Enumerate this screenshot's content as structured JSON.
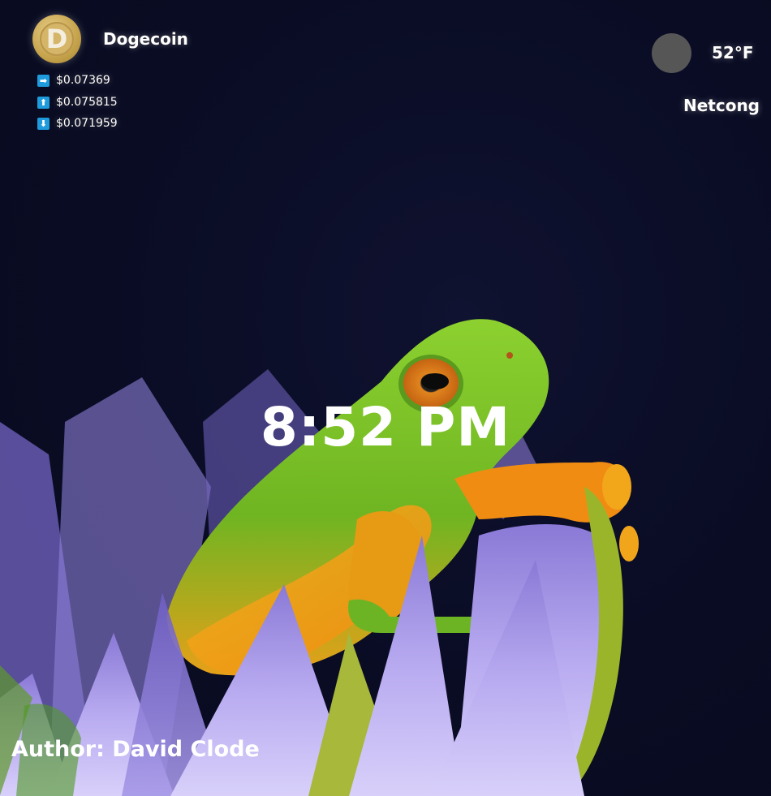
{
  "crypto": {
    "name": "Dogecoin",
    "logo_letter": "D",
    "prices": [
      {
        "icon": "arrow-right-icon",
        "glyph": "➡",
        "value": "$0.07369"
      },
      {
        "icon": "arrow-up-icon",
        "glyph": "⬆",
        "value": "$0.075815"
      },
      {
        "icon": "arrow-down-icon",
        "glyph": "⬇",
        "value": "$0.071959"
      }
    ],
    "icon_color": "#1e9bdc"
  },
  "weather": {
    "temperature": "52°F",
    "location": "Netcong",
    "icon": "weather-icon"
  },
  "clock": {
    "time": "8:52 PM"
  },
  "background": {
    "author": "Author: David Clode",
    "subject": "frog-on-water-lily"
  }
}
